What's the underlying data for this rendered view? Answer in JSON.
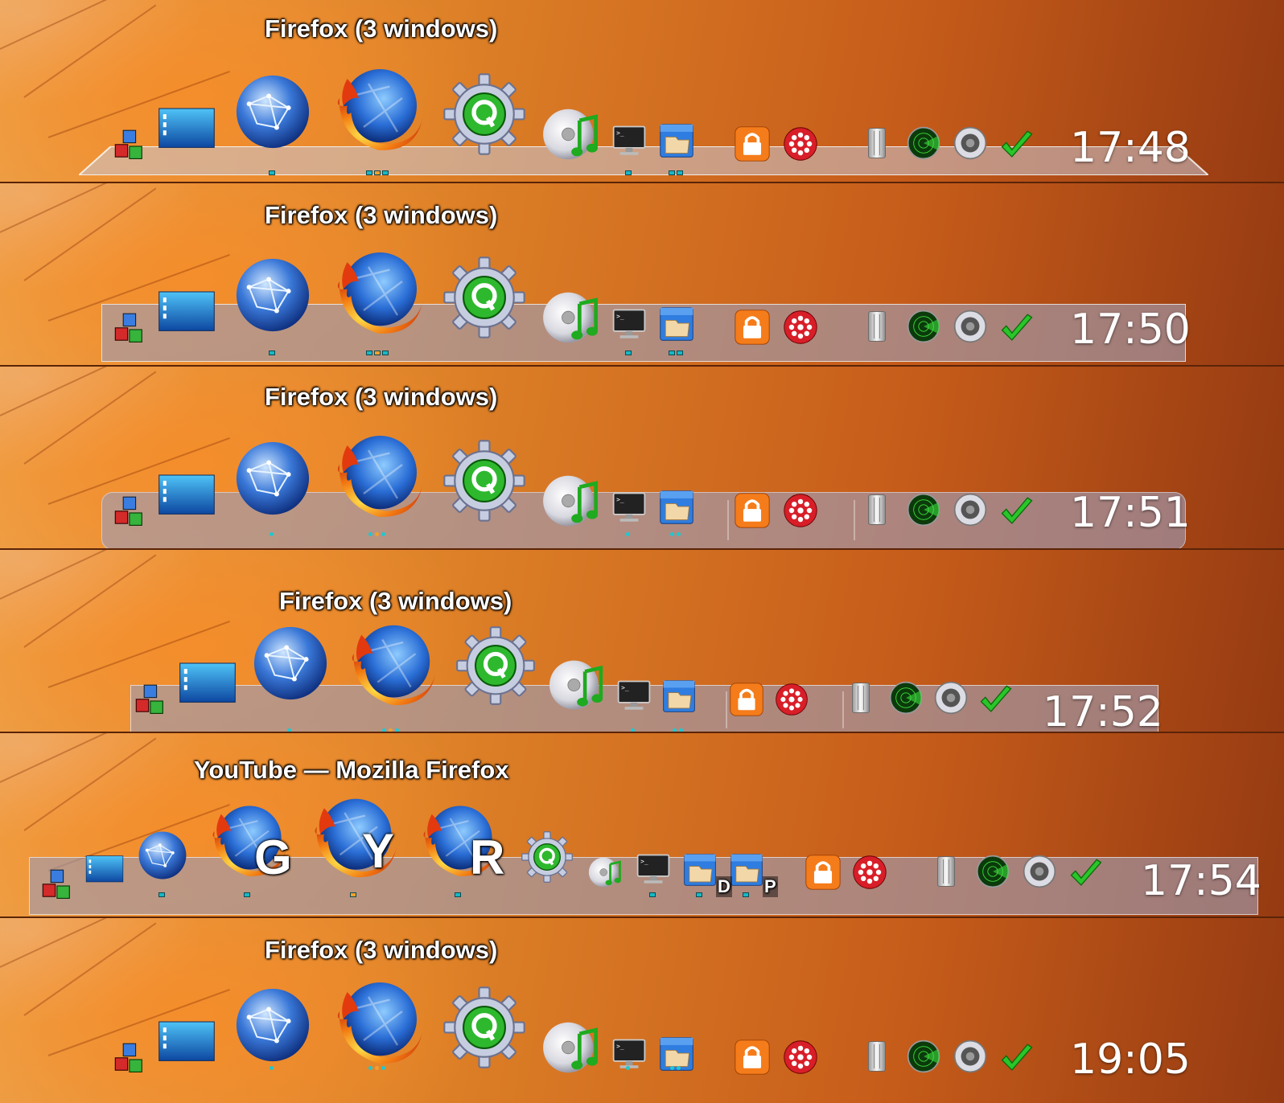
{
  "icons": [
    "cubes-icon",
    "desktop-icon",
    "network-globe-icon",
    "firefox-icon",
    "qt-gear-icon",
    "music-disc-icon",
    "terminal-icon",
    "file-manager-icon",
    "lock-icon",
    "kde-connect-icon",
    "trash-icon",
    "radar-icon",
    "speaker-icon",
    "checkmark-icon"
  ],
  "strips": [
    {
      "tooltip": "Firefox (3 windows)",
      "clock": "17:48"
    },
    {
      "tooltip": "Firefox (3 windows)",
      "clock": "17:50"
    },
    {
      "tooltip": "Firefox (3 windows)",
      "clock": "17:51"
    },
    {
      "tooltip": "Firefox (3 windows)",
      "clock": "17:52"
    },
    {
      "tooltip": "YouTube — Mozilla Firefox",
      "clock": "17:54",
      "firefox_windows": [
        "G",
        "Y",
        "R"
      ],
      "badges": [
        "D",
        "P"
      ]
    },
    {
      "tooltip": "Firefox (3 windows)",
      "clock": "19:05"
    }
  ]
}
